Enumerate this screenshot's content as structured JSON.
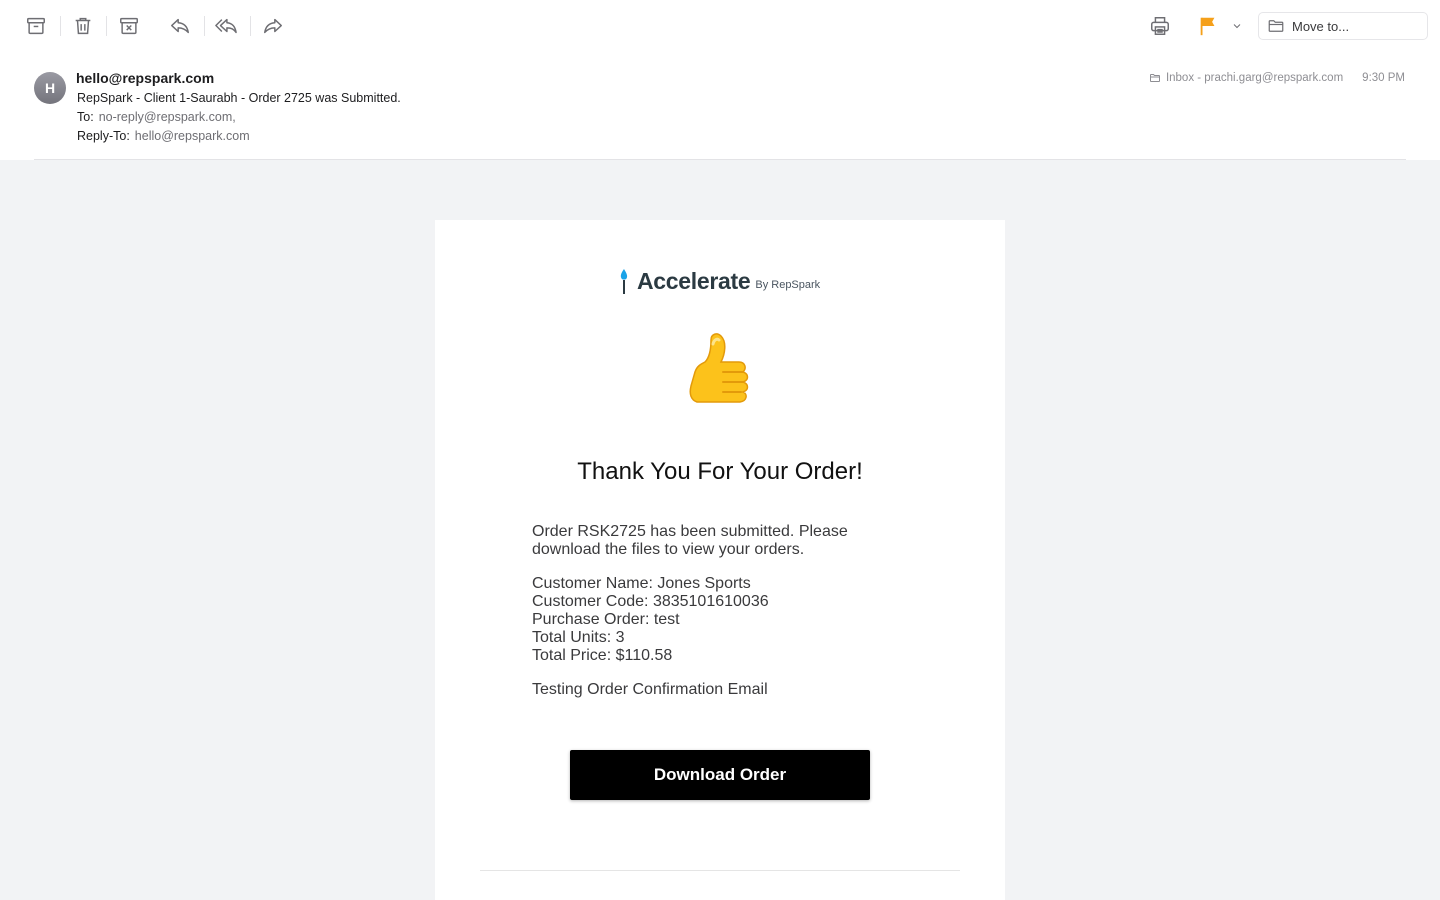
{
  "toolbar": {
    "move_to_label": "Move to..."
  },
  "header": {
    "avatar_initial": "H",
    "from": "hello@repspark.com",
    "subject": "RepSpark - Client 1-Saurabh - Order 2725 was Submitted.",
    "to_label": "To:",
    "to_value": "no-reply@repspark.com,",
    "reply_to_label": "Reply-To:",
    "reply_to_value": "hello@repspark.com",
    "mailbox": "Inbox - prachi.garg@repspark.com",
    "time": "9:30 PM"
  },
  "email": {
    "logo_name": "Accelerate",
    "logo_by": "By RepSpark",
    "title": "Thank You For Your Order!",
    "intro": "Order RSK2725 has been submitted. Please download the files to view your orders.",
    "customer_name": "Customer Name: Jones Sports",
    "customer_code": "Customer Code: 3835101610036",
    "purchase_order": "Purchase Order: test",
    "total_units": "Total Units: 3",
    "total_price": "Total Price: $110.58",
    "note": "Testing Order Confirmation Email",
    "download_label": "Download Order"
  },
  "colors": {
    "flag": "#f5a01a",
    "logo_flame": "#1aa3e8",
    "button": "#000000",
    "body_bg": "#f2f3f5"
  }
}
